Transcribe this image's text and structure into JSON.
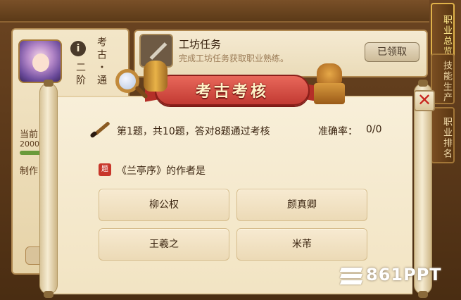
{
  "background": {
    "left_card": {
      "rank_text": "考古・通",
      "level_text": "二阶",
      "current_label": "当前",
      "progress_value": "2000",
      "craft_label": "制作"
    },
    "task_card": {
      "title": "工坊任务",
      "description": "完成工坊任务获取职业熟练。",
      "claimed_button": "已领取"
    },
    "side_tabs": [
      "职业总览",
      "技能生产",
      "职业排名"
    ]
  },
  "dialog": {
    "title": "考古考核",
    "header_text": "第1题，共10题，答对8题通过考核",
    "accuracy_label": "准确率：",
    "accuracy_value": "0/0",
    "question": "《兰亭序》的作者是",
    "options": [
      "柳公权",
      "颜真卿",
      "王羲之",
      "米芾"
    ],
    "close_icon": "close-x-icon"
  },
  "watermark": "861PPT",
  "colors": {
    "banner_red": "#c23a33",
    "paper": "#f5e8cb",
    "wood": "#5a3a1c",
    "close_red": "#c8241e"
  }
}
